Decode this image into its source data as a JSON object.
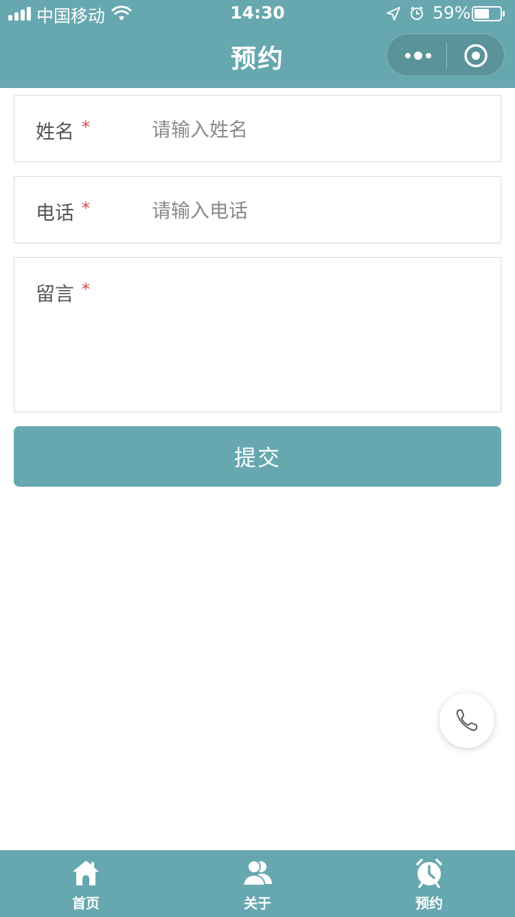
{
  "status_bar": {
    "carrier": "中国移动",
    "time": "14:30",
    "battery_percent": "59%",
    "battery_level": 0.59
  },
  "header": {
    "title": "预约",
    "more_icon": "more-dots-icon",
    "target_icon": "target-icon"
  },
  "form": {
    "name": {
      "label": "姓名",
      "required_mark": "*",
      "placeholder": "请输入姓名",
      "value": ""
    },
    "phone": {
      "label": "电话",
      "required_mark": "*",
      "placeholder": "请输入电话",
      "value": ""
    },
    "message": {
      "label": "留言",
      "required_mark": "*",
      "value": ""
    },
    "submit_label": "提交"
  },
  "fab": {
    "icon": "phone-icon"
  },
  "tabbar": {
    "items": [
      {
        "label": "首页",
        "icon": "home-icon"
      },
      {
        "label": "关于",
        "icon": "users-icon"
      },
      {
        "label": "预约",
        "icon": "alarm-clock-icon"
      }
    ]
  },
  "colors": {
    "primary": "#67a8b0",
    "required": "#d94a4a",
    "border": "#d9d9d9"
  }
}
